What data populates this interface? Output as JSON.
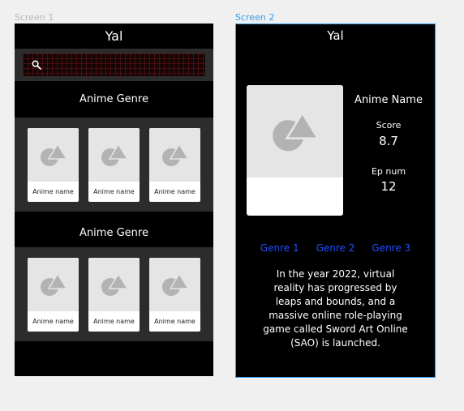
{
  "canvas": {
    "screen1_label": "Screen 1",
    "screen2_label": "Screen 2"
  },
  "screen1": {
    "title": "Yal",
    "search": {
      "placeholder": ""
    },
    "sections": [
      {
        "title": "Anime Genre",
        "cards": [
          "Anime name",
          "Anime name",
          "Anime name"
        ]
      },
      {
        "title": "Anime Genre",
        "cards": [
          "Anime name",
          "Anime name",
          "Anime name"
        ]
      }
    ]
  },
  "screen2": {
    "title": "Yal",
    "anime_name": "Anime Name",
    "score_label": "Score",
    "score_value": "8.7",
    "ep_label": "Ep num",
    "ep_value": "12",
    "genres": [
      "Genre 1",
      "Genre 2",
      "Genre 3"
    ],
    "description": "In the year 2022, virtual reality has progressed by leaps and bounds, and a massive online role-playing game called Sword Art Online (SAO) is launched."
  },
  "icons": {
    "search": "search-icon",
    "placeholder_image": "image-placeholder-icon"
  },
  "colors": {
    "accent_selection": "#2f9df0",
    "genre_link": "#1f4fff",
    "screen_bg": "#000000",
    "panel_bg": "#2c2c2c"
  }
}
